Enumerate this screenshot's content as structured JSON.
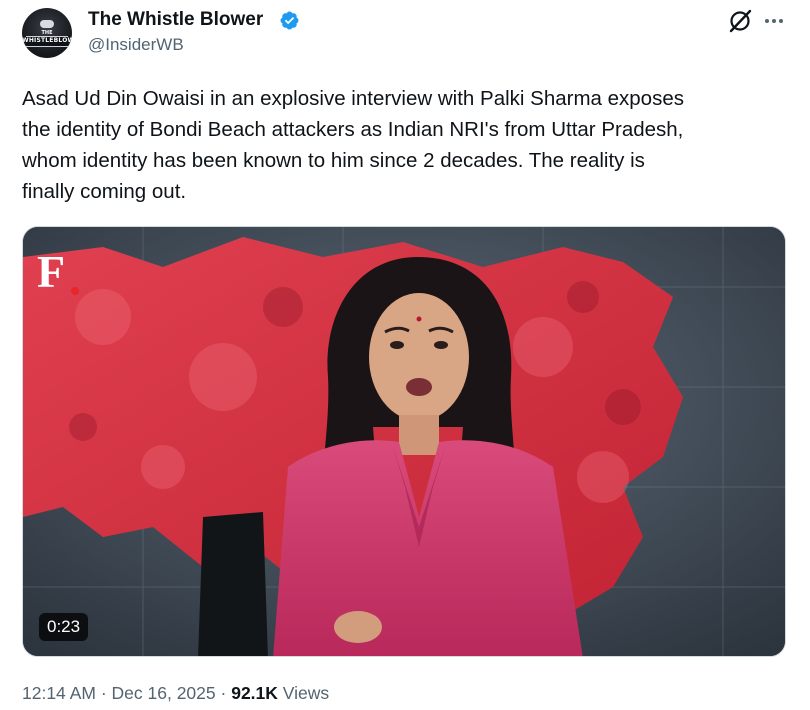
{
  "author": {
    "display_name": "The Whistle Blower",
    "handle": "@InsiderWB",
    "verified": true,
    "avatar_text_top": "THE",
    "avatar_text": "WHISTLEBLOWER"
  },
  "actions": {
    "grok_icon": "grok-icon",
    "more_icon": "more-icon"
  },
  "tweet": {
    "text": "Asad Ud Din Owaisi in an explosive interview with Palki Sharma exposes\nthe identity of Bondi Beach attackers as Indian NRI's from Uttar Pradesh,\nwhom identity has been known to him since 2 decades. The reality is\nfinally coming out."
  },
  "media": {
    "type": "video",
    "logo_letter": "F",
    "duration": "0:23"
  },
  "meta": {
    "time": "12:14 AM",
    "separator": "·",
    "date": "Dec 16, 2025",
    "views_count": "92.1K",
    "views_label": "Views"
  },
  "colors": {
    "verified_blue": "#1d9bf0",
    "text_primary": "#0f1419",
    "text_secondary": "#536471",
    "logo_dot_red": "#e8262b"
  }
}
